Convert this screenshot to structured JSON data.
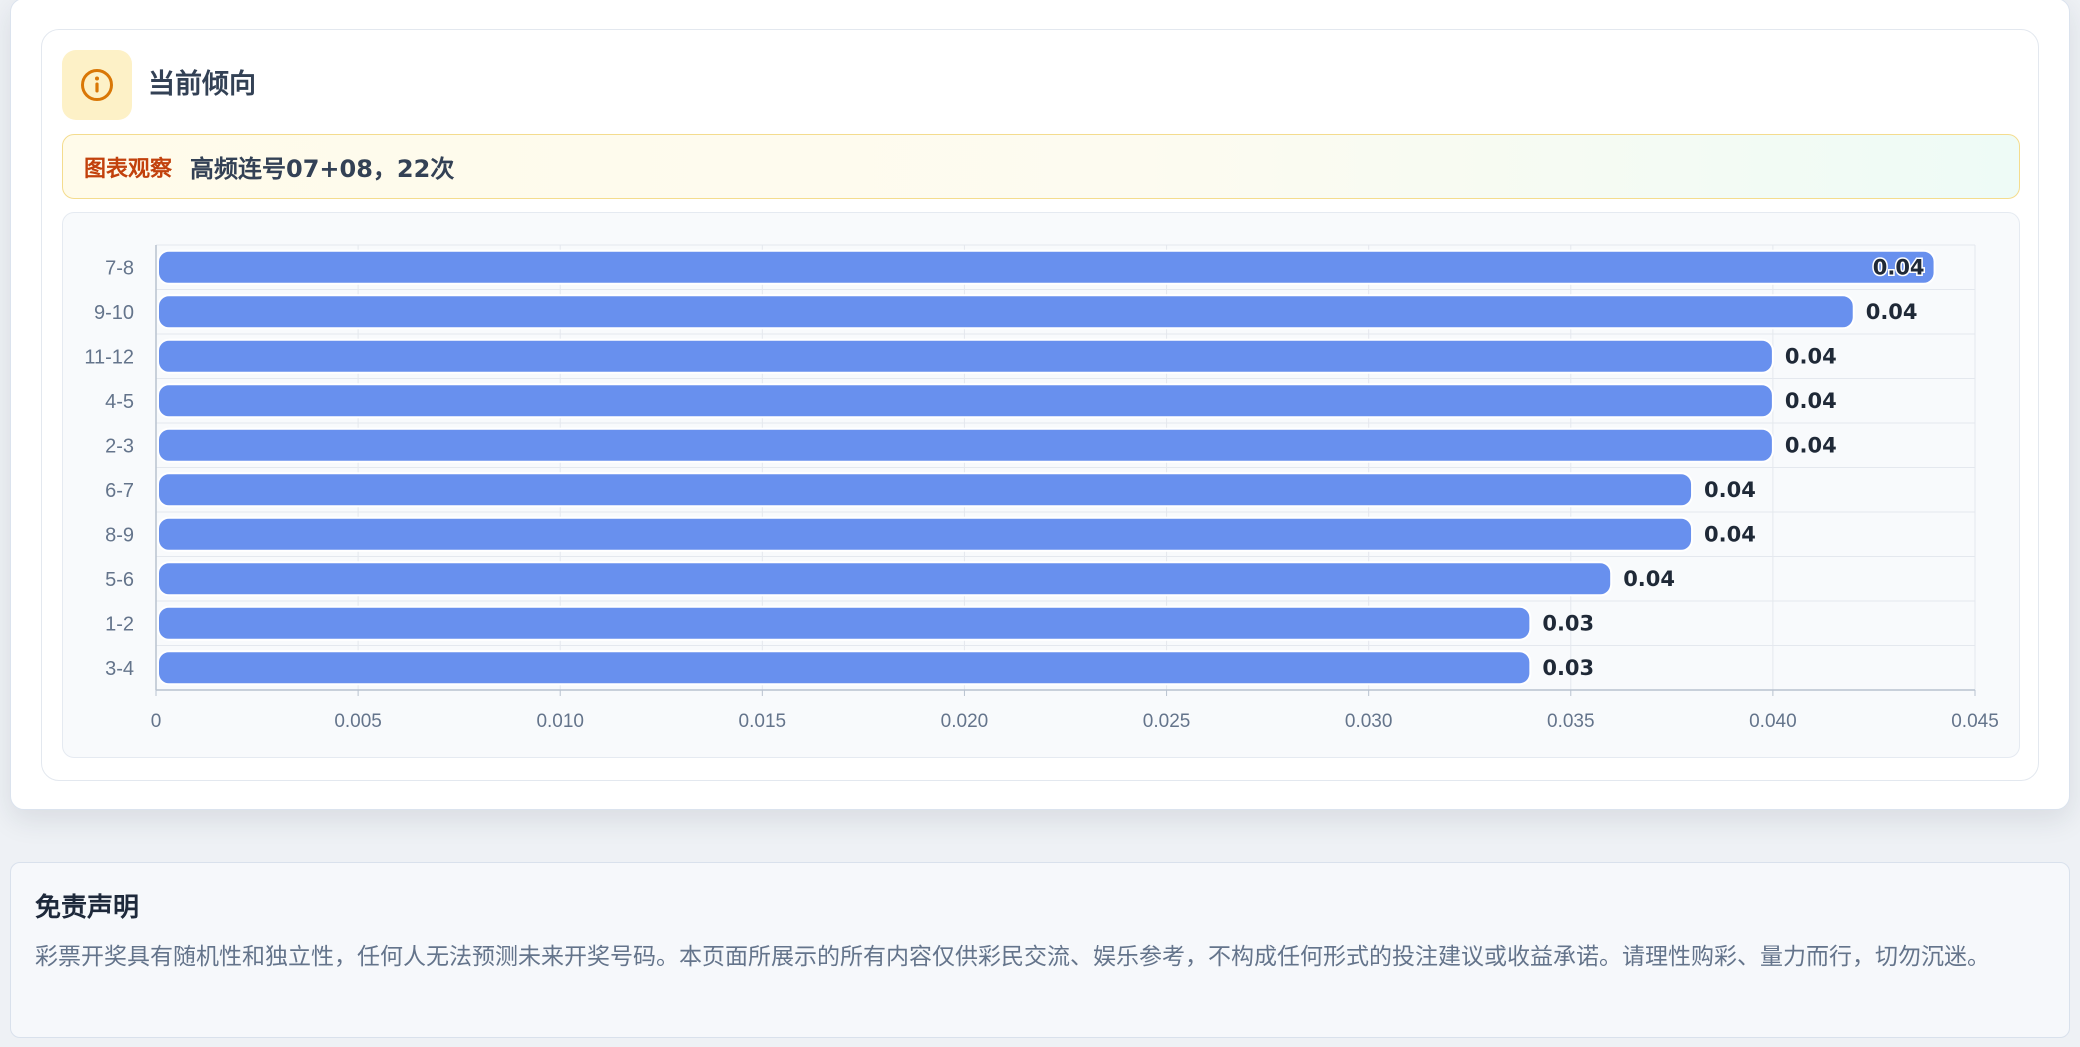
{
  "card": {
    "title": "当前倾向",
    "icon": "info-icon",
    "accent": "#d97706"
  },
  "observation": {
    "tag": "图表观察",
    "text": "高频连号07+08，22次"
  },
  "chart_data": {
    "type": "bar",
    "orientation": "horizontal",
    "categories": [
      "7-8",
      "9-10",
      "11-12",
      "4-5",
      "2-3",
      "6-7",
      "8-9",
      "5-6",
      "1-2",
      "3-4"
    ],
    "values": [
      0.044,
      0.042,
      0.04,
      0.04,
      0.04,
      0.038,
      0.038,
      0.036,
      0.034,
      0.034
    ],
    "data_labels": [
      "0.04",
      "0.04",
      "0.04",
      "0.04",
      "0.04",
      "0.04",
      "0.04",
      "0.04",
      "0.03",
      "0.03"
    ],
    "x_ticks": [
      "0",
      "0.005",
      "0.010",
      "0.015",
      "0.020",
      "0.025",
      "0.030",
      "0.035",
      "0.040",
      "0.045"
    ],
    "xlim": [
      0,
      0.045
    ],
    "grid": true,
    "bar_color": "#6890ee"
  },
  "disclaimer": {
    "title": "免责声明",
    "text": "彩票开奖具有随机性和独立性，任何人无法预测未来开奖号码。本页面所展示的所有内容仅供彩民交流、娱乐参考，不构成任何形式的投注建议或收益承诺。请理性购彩、量力而行，切勿沉迷。"
  }
}
